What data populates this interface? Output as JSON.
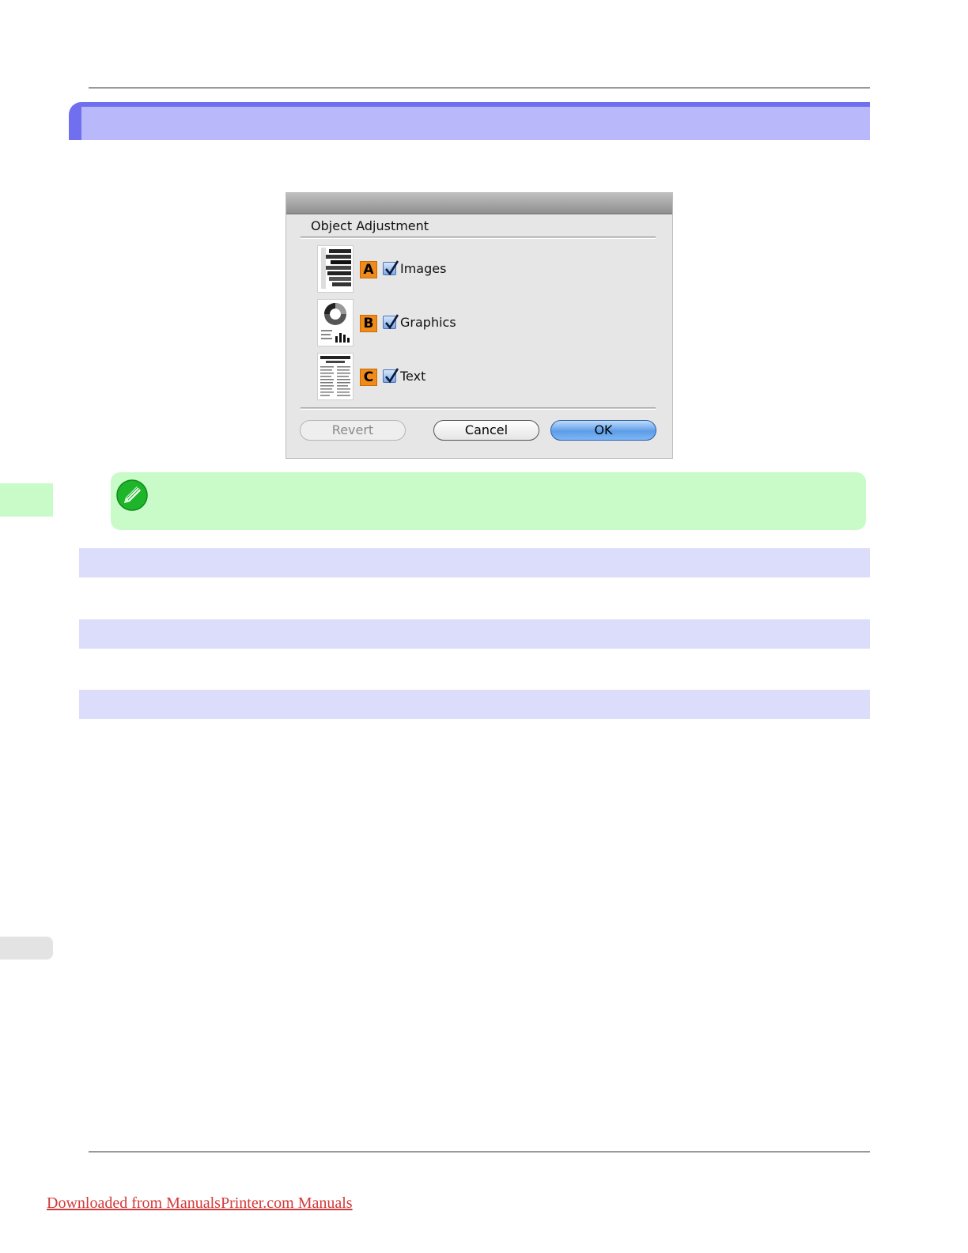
{
  "dialog": {
    "group_title": "Object Adjustment",
    "options": [
      {
        "badge": "A",
        "label": "Images",
        "checked": true,
        "icon": "images-thumbnail-icon"
      },
      {
        "badge": "B",
        "label": "Graphics",
        "checked": true,
        "icon": "graphics-thumbnail-icon"
      },
      {
        "badge": "C",
        "label": "Text",
        "checked": true,
        "icon": "text-thumbnail-icon"
      }
    ],
    "buttons": {
      "revert": "Revert",
      "cancel": "Cancel",
      "ok": "OK"
    }
  },
  "note": {
    "icon": "pencil-note-icon"
  },
  "footer": {
    "link_text": "Downloaded from ManualsPrinter.com Manuals"
  },
  "colors": {
    "section_header": "#6f6ff0",
    "section_header_inner": "#b8b8fb",
    "note_background": "#c9fbc9",
    "sub_bar": "#dcdcfb",
    "badge_orange": "#f08a1a",
    "link_red": "#d43a3a"
  }
}
